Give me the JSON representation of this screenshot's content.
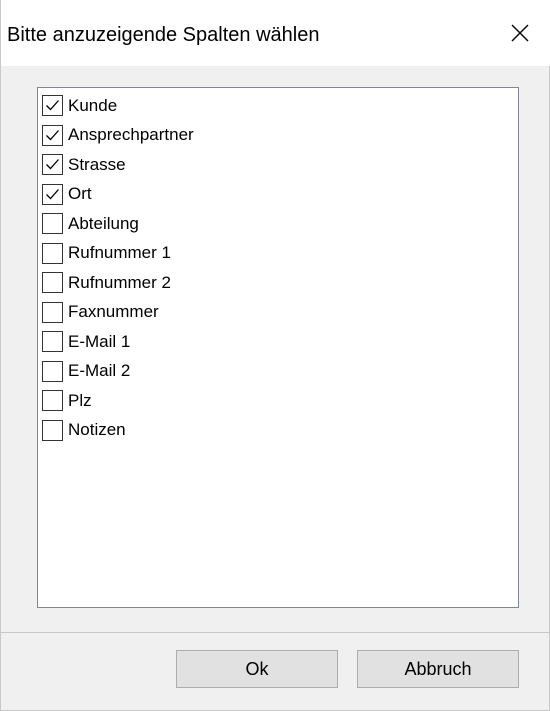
{
  "window": {
    "title": "Bitte anzuzeigende Spalten wählen",
    "close_icon": "close-icon"
  },
  "columns": [
    {
      "label": "Kunde",
      "checked": true
    },
    {
      "label": "Ansprechpartner",
      "checked": true
    },
    {
      "label": "Strasse",
      "checked": true
    },
    {
      "label": "Ort",
      "checked": true
    },
    {
      "label": "Abteilung",
      "checked": false
    },
    {
      "label": "Rufnummer 1",
      "checked": false
    },
    {
      "label": "Rufnummer 2",
      "checked": false
    },
    {
      "label": "Faxnummer",
      "checked": false
    },
    {
      "label": "E-Mail 1",
      "checked": false
    },
    {
      "label": "E-Mail 2",
      "checked": false
    },
    {
      "label": "Plz",
      "checked": false
    },
    {
      "label": "Notizen",
      "checked": false
    }
  ],
  "buttons": {
    "ok_label": "Ok",
    "cancel_label": "Abbruch"
  }
}
